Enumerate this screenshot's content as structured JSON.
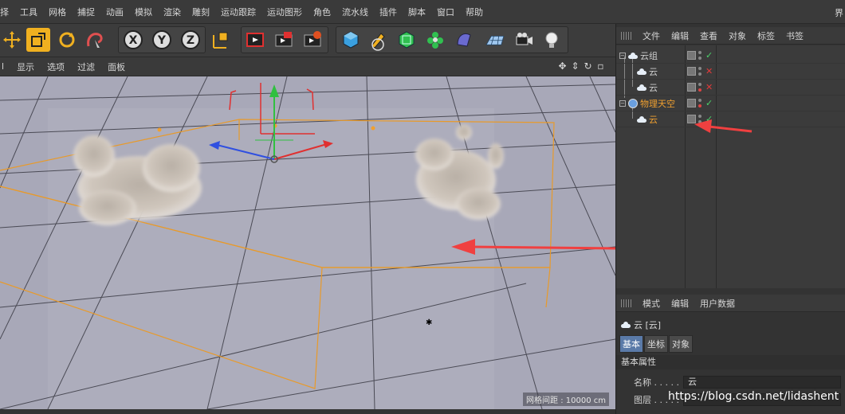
{
  "menubar": {
    "items": [
      "择",
      "工具",
      "网格",
      "捕捉",
      "动画",
      "模拟",
      "渲染",
      "雕刻",
      "运动跟踪",
      "运动图形",
      "角色",
      "流水线",
      "插件",
      "脚本",
      "窗口",
      "帮助"
    ],
    "right_cut": "界"
  },
  "toolbar": {
    "icons": [
      "move-icon",
      "scale-icon",
      "rotate-icon",
      "live-select-icon",
      "lock-x-icon",
      "lock-y-icon",
      "lock-z-icon",
      "coordinate-system-icon",
      "render-view-icon",
      "render-picture-viewer-icon",
      "render-settings-icon",
      "cube-icon",
      "pen-icon",
      "subdivision-icon",
      "cloner-icon",
      "deformer-icon",
      "floor-icon",
      "camera-icon",
      "light-icon"
    ],
    "axis_labels": {
      "x": "X",
      "y": "Y",
      "z": "Z"
    }
  },
  "viewport": {
    "menu": [
      "l",
      "显示",
      "选项",
      "过滤",
      "面板"
    ],
    "grid_label": "网格间距 : 10000 cm",
    "nav_icons": [
      "pan-icon",
      "dolly-icon",
      "rotate-view-icon",
      "maximize-icon"
    ]
  },
  "object_manager": {
    "menu": [
      "文件",
      "编辑",
      "查看",
      "对象",
      "标签",
      "书签"
    ],
    "rows": [
      {
        "name": "云组",
        "icon": "cloud-group-icon",
        "status": "ok",
        "color": "#cfcfcf"
      },
      {
        "name": "云",
        "icon": "cloud-icon",
        "status": "x",
        "color": "#cfcfcf"
      },
      {
        "name": "云",
        "icon": "cloud-icon",
        "status": "x",
        "color": "#cfcfcf"
      },
      {
        "name": "物理天空",
        "icon": "physical-sky-icon",
        "status": "ok",
        "color": "#f0a030"
      },
      {
        "name": "云",
        "icon": "cloud-icon",
        "status": "ok",
        "color": "#f0a030"
      }
    ],
    "status_symbols": {
      "ok": "✓",
      "x": "✕"
    }
  },
  "attribute_manager": {
    "menu": [
      "模式",
      "编辑",
      "用户数据"
    ],
    "title": "云 [云]",
    "tabs": [
      "基本",
      "坐标",
      "对象"
    ],
    "section": "基本属性",
    "fields": [
      {
        "label": "名称 . . . . .",
        "value": "云"
      },
      {
        "label": "图层 . . . . .",
        "value": ""
      }
    ]
  },
  "watermark": "https://blog.csdn.net/lidashent",
  "colors": {
    "accent_orange": "#f0a030",
    "annotation_red": "#f04040",
    "viewport_bg": "#a9a9b9",
    "status_ok": "#4cd36a",
    "status_x": "#e23b3b"
  }
}
